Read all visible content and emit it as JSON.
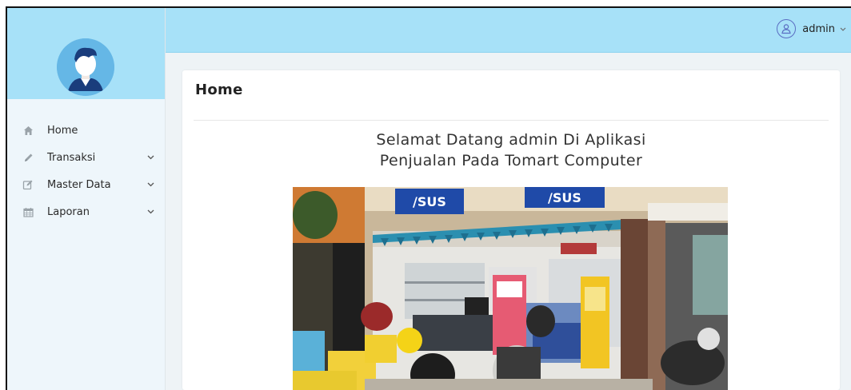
{
  "sidebar": {
    "items": [
      {
        "label": "Home",
        "icon": "home-icon",
        "has_submenu": false
      },
      {
        "label": "Transaksi",
        "icon": "pencil-icon",
        "has_submenu": true
      },
      {
        "label": "Master Data",
        "icon": "edit-icon",
        "has_submenu": true
      },
      {
        "label": "Laporan",
        "icon": "calendar-icon",
        "has_submenu": true
      }
    ]
  },
  "topbar": {
    "username": "admin",
    "user_icon": "user-icon"
  },
  "main": {
    "title": "Home",
    "welcome_line1": "Selamat Datang admin Di Aplikasi",
    "welcome_line2": "Penjualan Pada Tomart Computer",
    "photo_sign_text": "/SUS"
  },
  "colors": {
    "header_bg": "#a7e1f8",
    "sidebar_bg": "#eef6fb",
    "main_bg": "#eef3f6",
    "card_bg": "#ffffff",
    "avatar_bg": "#65b7e6",
    "asus_blue": "#1f4aa8"
  }
}
